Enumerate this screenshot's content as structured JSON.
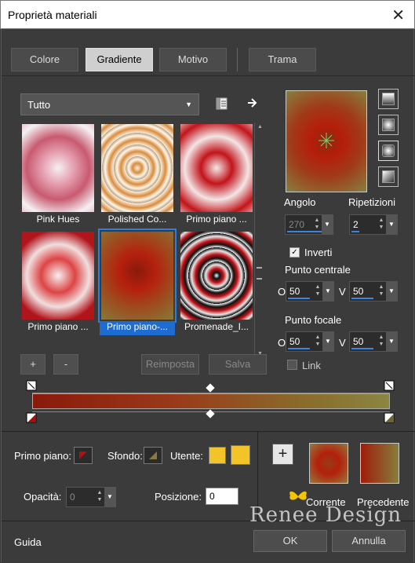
{
  "window": {
    "title": "Proprietà materiali",
    "close_glyph": "✕"
  },
  "tabs": [
    {
      "label": "Colore"
    },
    {
      "label": "Gradiente"
    },
    {
      "label": "Motivo"
    },
    {
      "label": "Trama"
    }
  ],
  "filter": {
    "value": "Tutto"
  },
  "thumbnails": [
    {
      "label": "Pink Hues"
    },
    {
      "label": "Polished Co..."
    },
    {
      "label": "Primo piano ..."
    },
    {
      "label": "Primo piano ..."
    },
    {
      "label": "Primo piano-..."
    },
    {
      "label": "Promenade_I..."
    }
  ],
  "list_buttons": {
    "add": "+",
    "remove": "-",
    "reset": "Reimposta",
    "save": "Salva"
  },
  "controls": {
    "angle_label": "Angolo",
    "angle_value": "270",
    "repeat_label": "Ripetizioni",
    "repeat_value": "2",
    "invert_label": "Inverti",
    "center_label": "Punto centrale",
    "center_h_label": "O",
    "center_h": "50",
    "center_v_label": "V",
    "center_v": "50",
    "focal_label": "Punto focale",
    "focal_h_label": "O",
    "focal_h": "50",
    "focal_v_label": "V",
    "focal_v": "50",
    "link_label": "Link"
  },
  "bottom": {
    "foreground_label": "Primo piano:",
    "background_label": "Sfondo:",
    "user_label": "Utente:",
    "opacity_label": "Opacità:",
    "opacity_value": "0",
    "position_label": "Posizione:",
    "position_value": "0",
    "add_glyph": "+",
    "current_label": "Corrente",
    "previous_label": "Precedente",
    "help": "Guida",
    "ok": "OK",
    "cancel": "Annulla",
    "watermark": "Renee Design"
  },
  "colors": {
    "accent": "#1e6ccf",
    "user_color": "#f3c428",
    "gradient_red": "#9a1a0a",
    "gradient_olive": "#8a8640"
  }
}
